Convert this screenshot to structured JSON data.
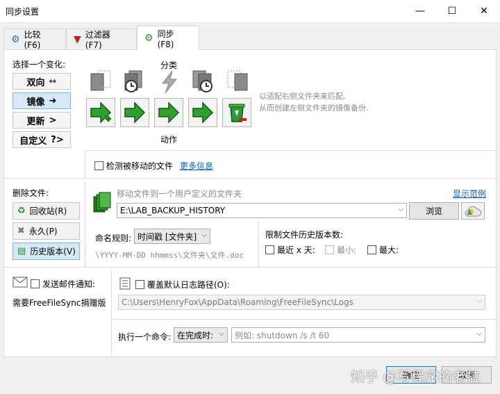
{
  "window": {
    "title": "同步设置",
    "minimize": "—",
    "maximize": "☐",
    "close": "✕"
  },
  "tabs": [
    {
      "label": "比较 (F6)"
    },
    {
      "label": "过滤器 (F7)"
    },
    {
      "label": "同步 (F8)"
    }
  ],
  "variant": {
    "heading": "选择一个变化:",
    "options": [
      {
        "label": "双向",
        "arrow": "↔"
      },
      {
        "label": "镜像",
        "arrow": "➜"
      },
      {
        "label": "更新",
        "arrow": ">"
      },
      {
        "label": "自定义",
        "arrow": "?>"
      }
    ]
  },
  "category_label": "分类",
  "action_label": "动作",
  "description_line1": "以适配右侧文件夹来匹配,",
  "description_line2": "从而创建左侧文件夹的镜像备份.",
  "detect_moved": {
    "label": "检测被移动的文件",
    "more_info": "更多信息"
  },
  "deletion": {
    "heading": "删除文件:",
    "buttons": [
      {
        "label": "回收站(R)"
      },
      {
        "label": "永久(P)"
      },
      {
        "label": "历史版本(V)"
      }
    ],
    "move_hint": "移动文件到一个用户定义的文件夹",
    "show_example": "显示范例",
    "path_value": "E:\\LAB_BACKUP_HISTORY",
    "browse_label": "浏览",
    "naming_label": "命名规则:",
    "naming_value": "时间戳 [文件夹]",
    "naming_example": "\\YYYY-MM-DD hhmmss\\文件夹\\文件.doc",
    "limit_heading": "限制文件历史版本数:",
    "limit_last_days": "最近 x 天:",
    "limit_min": "最小:",
    "limit_max": "最大:"
  },
  "email": {
    "label": "发送邮件通知:",
    "donation_note": "需要FreeFileSync捐赠版"
  },
  "log": {
    "label": "覆盖默认日志路径(O):",
    "path_value": "C:\\Users\\HenryFox\\AppData\\Roaming\\FreeFileSync\\Logs"
  },
  "command": {
    "label": "执行一个命令:",
    "when_value": "在完成时:",
    "placeholder": "例如: shutdown /s /t 60"
  },
  "footer": {
    "ok_label": "确定",
    "cancel_label": "取消",
    "watermark": "知乎 @写程序的老拉"
  }
}
